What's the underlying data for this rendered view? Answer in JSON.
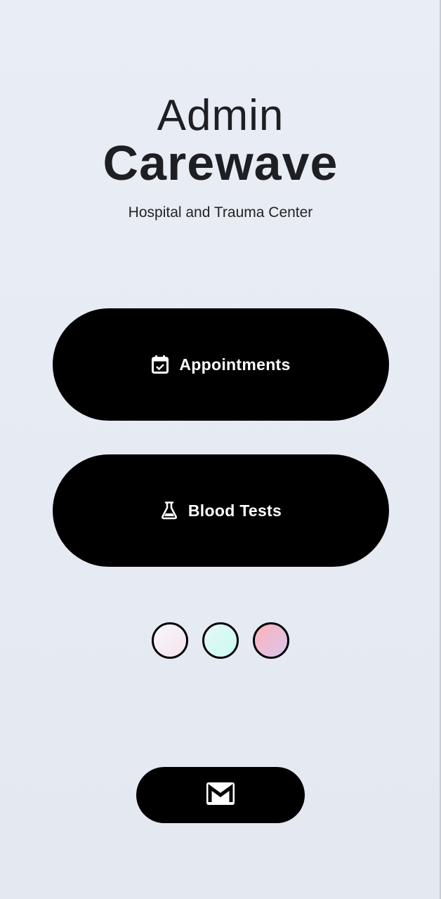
{
  "header": {
    "title_top": "Admin",
    "title_main": "Carewave",
    "subtitle": "Hospital and Trauma Center"
  },
  "actions": [
    {
      "label": "Appointments",
      "icon": "calendar-check-icon"
    },
    {
      "label": "Blood Tests",
      "icon": "flask-icon"
    }
  ],
  "theme_swatches": [
    {
      "name": "lavender-blush",
      "colors": [
        "#f5f7fb",
        "#f7e3ee"
      ]
    },
    {
      "name": "mint",
      "colors": [
        "#e6f7f7",
        "#c8fbf1"
      ]
    },
    {
      "name": "rose",
      "colors": [
        "#ffb3b8",
        "#d7c6ee"
      ]
    }
  ],
  "footer": {
    "mail_icon": "gmail-icon"
  },
  "colors": {
    "background": "#e8ecf3",
    "button": "#000000",
    "text": "#1e1f23"
  }
}
